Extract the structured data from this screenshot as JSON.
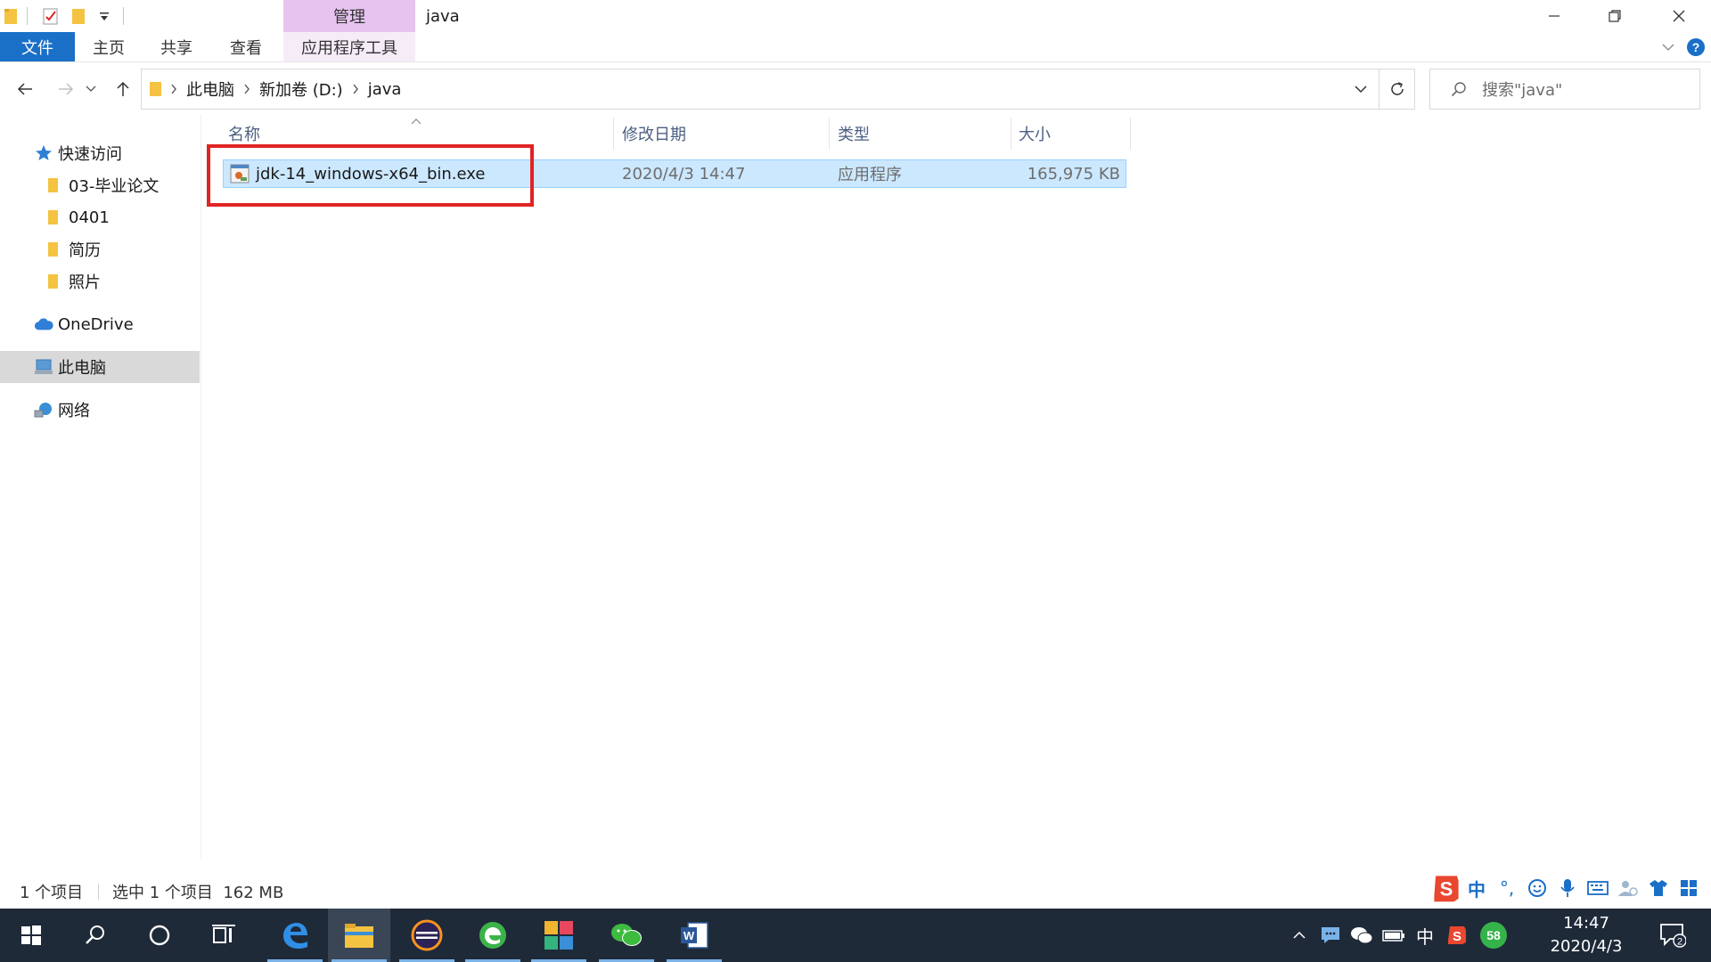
{
  "window": {
    "title": "java",
    "context_tab_group": "管理"
  },
  "ribbon": {
    "tabs": [
      {
        "label": "文件"
      },
      {
        "label": "主页"
      },
      {
        "label": "共享"
      },
      {
        "label": "查看"
      },
      {
        "label": "应用程序工具"
      }
    ],
    "help": "?"
  },
  "address": {
    "crumbs": [
      "此电脑",
      "新加卷 (D:)",
      "java"
    ]
  },
  "search": {
    "placeholder": "搜索\"java\""
  },
  "sidebar": {
    "quick_access": "快速访问",
    "pinned": [
      "03-毕业论文",
      "0401",
      "简历",
      "照片"
    ],
    "onedrive": "OneDrive",
    "this_pc": "此电脑",
    "network": "网络"
  },
  "columns": {
    "name": "名称",
    "date": "修改日期",
    "type": "类型",
    "size": "大小"
  },
  "files": [
    {
      "name": "jdk-14_windows-x64_bin.exe",
      "date": "2020/4/3 14:47",
      "type": "应用程序",
      "size": "165,975 KB"
    }
  ],
  "status": {
    "count": "1 个项目",
    "selected": "选中 1 个项目  162 MB"
  },
  "ime": {
    "mode": "中",
    "punct": "°,"
  },
  "taskbar": {
    "tray_lang": "中",
    "badge": "58",
    "time": "14:47",
    "date": "2020/4/3",
    "notifications": "2"
  },
  "colors": {
    "accent": "#1a6fc7",
    "selection_bg": "#cce8ff",
    "selection_border": "#99d1ff",
    "context_tab": "#e7c4f0",
    "highlight": "#e02424",
    "taskbar": "#1f2a39",
    "folder": "#f5c342"
  }
}
